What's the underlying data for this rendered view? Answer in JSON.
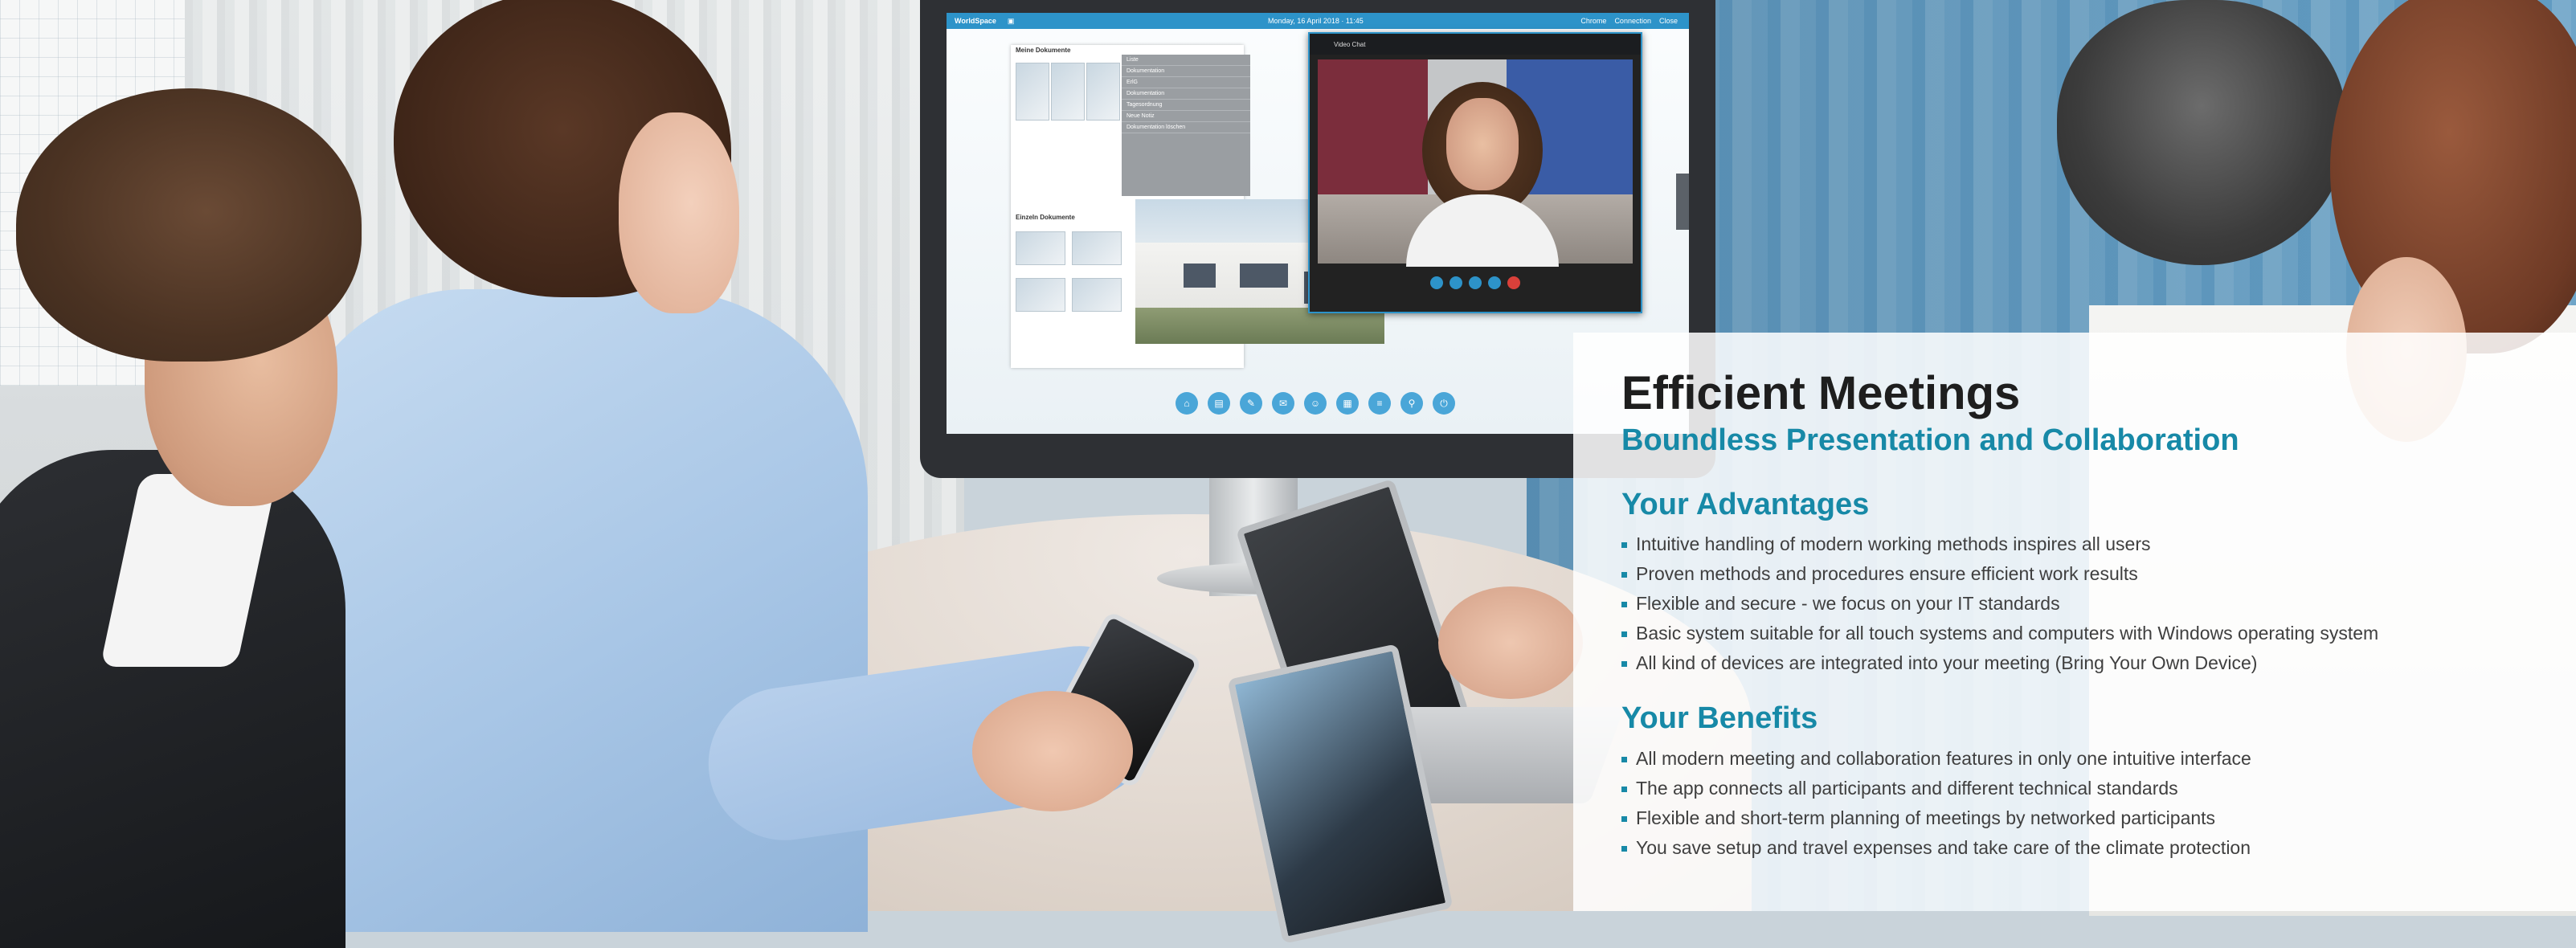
{
  "screen": {
    "app_name": "WorldSpace",
    "date": "Monday, 16 April 2018 · 11:45",
    "header_right": [
      "Chrome",
      "Connection",
      "Close"
    ],
    "panel_title": "Meine Dokumente",
    "panel_title_2": "Einzeln Dokumente",
    "popover_items": [
      "Liste",
      "Dokumentation",
      "ErlG",
      "Dokumentation",
      "Tagesordnung",
      "Neue Notiz",
      "Dokumentation löschen"
    ],
    "video_title": "Video Chat",
    "dock_icons": [
      "home-icon",
      "document-icon",
      "pen-icon",
      "chat-icon",
      "user-icon",
      "calendar-icon",
      "list-icon",
      "link-icon",
      "power-icon"
    ]
  },
  "headline": {
    "title": "Efficient Meetings",
    "subtitle": "Boundless Presentation and Collaboration"
  },
  "advantages": {
    "title": "Your Advantages",
    "items": [
      "Intuitive handling of modern working methods inspires all users",
      "Proven methods and procedures ensure efficient work results",
      "Flexible and secure - we focus on your IT standards",
      "Basic system suitable for all touch systems and computers with Windows operating system",
      "All kind of devices are integrated into your meeting (Bring Your Own Device)"
    ]
  },
  "benefits": {
    "title": "Your Benefits",
    "items": [
      "All modern meeting and collaboration features in only one intuitive interface",
      "The app connects all participants and different technical standards",
      "Flexible and short-term planning of meetings by networked participants",
      "You save setup and travel expenses and take care of the climate protection"
    ]
  },
  "colors": {
    "accent": "#1789a7",
    "title": "#1e1e1e",
    "body_text": "#3f3f3f",
    "screen_header": "#2d93c9"
  }
}
